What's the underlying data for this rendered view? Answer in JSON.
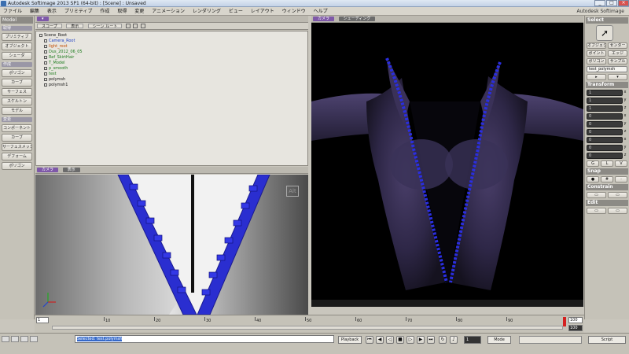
{
  "window": {
    "title": "Autodesk Softimage 2013 SP1 (64-bit) : [Scene] : Unsaved",
    "brand": "Autodesk Softimage"
  },
  "menubar": {
    "items": [
      "ファイル",
      "編集",
      "表示",
      "プリミティブ",
      "作成",
      "取得",
      "変更",
      "アニメーション",
      "レンダリング",
      "ビュー",
      "レイアウト",
      "ウィンドウ",
      "ヘルプ"
    ]
  },
  "left_toolbar": {
    "mode": "Model",
    "sections": [
      {
        "title": "取得",
        "buttons": [
          "プリミティブ",
          "オブジェクト",
          "シェーダ"
        ]
      },
      {
        "title": "作成",
        "buttons": [
          "ポリゴン",
          "カーブ",
          "サーフェス",
          "スケルトン",
          "モデル"
        ]
      },
      {
        "title": "変更",
        "buttons": [
          "コンポーネント",
          "カーブ",
          "サーフェスメッシュ",
          "デフォーム",
          "ポリゴン"
        ]
      }
    ]
  },
  "explorer": {
    "header": [
      "スコープ",
      "表示",
      "シーン ルート"
    ],
    "items": [
      {
        "label": "Scene_Root",
        "color": "#111111"
      },
      {
        "label": "Camera_Root",
        "color": "#1d3fc4"
      },
      {
        "label": "light_root",
        "color": "#c24c00"
      },
      {
        "label": "Dus_2012_06_05",
        "color": "#1b7a1b"
      },
      {
        "label": "Ref_SkirtHair",
        "color": "#1b7a1b"
      },
      {
        "label": "T_Model",
        "color": "#1b7a1b"
      },
      {
        "label": "p_smooth",
        "color": "#1b7a1b"
      },
      {
        "label": "test",
        "color": "#1b7a1b"
      },
      {
        "label": "polymsh",
        "color": "#111111"
      },
      {
        "label": "polymsh1",
        "color": "#111111"
      }
    ]
  },
  "viewport_small": {
    "menus": [
      "カメラ",
      "表示"
    ],
    "watermark": "Alt"
  },
  "viewport_main": {
    "menus": [
      "カメラ",
      "シェーディング"
    ],
    "accent": "#2a2ee0"
  },
  "right_panel": {
    "select_title": "Select",
    "buttons_row1": [
      "オブジェクト",
      "センター"
    ],
    "buttons_row2": [
      "ポイント",
      "エッジ"
    ],
    "buttons_row3": [
      "ポリゴン",
      "サンプル"
    ],
    "selected_object": "test_polymsh",
    "transform_title": "Transform",
    "axes": [
      "x",
      "y",
      "z"
    ],
    "snap_title": "Snap",
    "constrain_title": "Constrain",
    "edit_title": "Edit"
  },
  "timeline": {
    "start": "1",
    "end": "100",
    "current": "100",
    "ticks": [
      "10",
      "20",
      "30",
      "40",
      "50",
      "60",
      "70",
      "80",
      "90"
    ]
  },
  "statusbar": {
    "command": "Selected: test.polymsh",
    "playback_label": "Playback",
    "frame_field": "1",
    "mode_label": "Mode",
    "script_label": "Script"
  }
}
